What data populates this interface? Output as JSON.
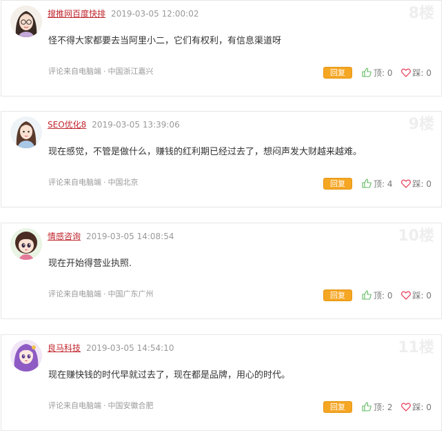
{
  "comments": [
    {
      "username": "搜推网百度快排",
      "time": "2019-03-05 12:00:02",
      "floor": "8楼",
      "content": "怪不得大家都要去当阿里小二，它们有权利，有信息渠道呀",
      "source": "评论来自电脑端",
      "location": "中国浙江嘉兴",
      "reply_label": "回复",
      "up_label": "顶: 0",
      "down_label": "踩: 0"
    },
    {
      "username": "SEO优化8",
      "time": "2019-03-05 13:39:06",
      "floor": "9楼",
      "content": "现在感觉，不管是做什么，赚钱的红利期已经过去了，想闷声发大财越来越难。",
      "source": "评论来自电脑端",
      "location": "中国北京",
      "reply_label": "回复",
      "up_label": "顶: 4",
      "down_label": "踩: 0"
    },
    {
      "username": "情感咨询",
      "time": "2019-03-05 14:08:54",
      "floor": "10楼",
      "content": "现在开始得营业执照.",
      "source": "评论来自电脑端",
      "location": "中国广东广州",
      "reply_label": "回复",
      "up_label": "顶: 0",
      "down_label": "踩: 0"
    },
    {
      "username": "良马科技",
      "time": "2019-03-05 14:54:10",
      "floor": "11楼",
      "content": "现在赚快钱的时代早就过去了，现在都是品牌，用心的时代。",
      "source": "评论来自电脑端",
      "location": "中国安徽合肥",
      "reply_label": "回复",
      "up_label": "顶: 2",
      "down_label": "踩: 0"
    }
  ],
  "meta_separator": "·",
  "colors": {
    "username": "#c0262d",
    "reply_button": "#f5a623",
    "thumb_icon": "#5cb85c",
    "heart_icon": "#e8465e"
  },
  "icons": {
    "up": "thumbs-up-icon",
    "down": "heart-icon"
  }
}
